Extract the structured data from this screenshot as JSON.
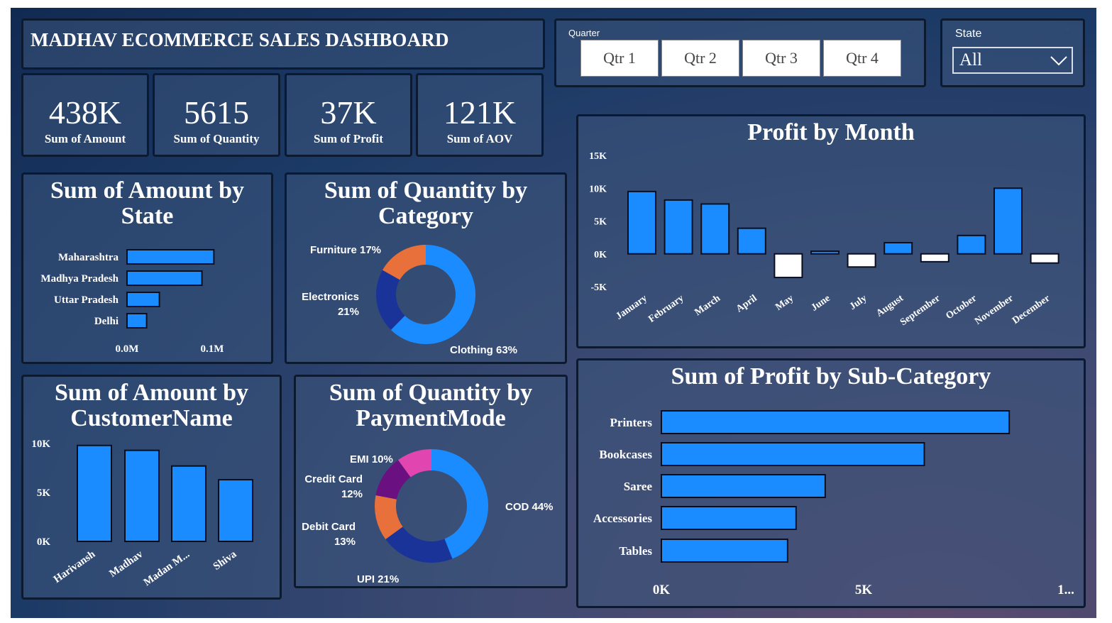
{
  "dashboard": {
    "title": "MADHAV ECOMMERCE SALES DASHBOARD"
  },
  "kpis": [
    {
      "value": "438K",
      "label": "Sum of Amount"
    },
    {
      "value": "5615",
      "label": "Sum of Quantity"
    },
    {
      "value": "37K",
      "label": "Sum of Profit"
    },
    {
      "value": "121K",
      "label": "Sum of AOV"
    }
  ],
  "quarter_slicer": {
    "label": "Quarter",
    "options": [
      "Qtr 1",
      "Qtr 2",
      "Qtr 3",
      "Qtr 4"
    ]
  },
  "state_slicer": {
    "label": "State",
    "selected": "All"
  },
  "colors": {
    "bar": "#1a8cff",
    "negative": "#ffffff",
    "outline": "#0a0f1f",
    "donut_dark": "#1a3399",
    "donut_orange": "#e8703a",
    "donut_purple": "#6b1080",
    "donut_pink": "#e045b0"
  },
  "chart_data": [
    {
      "type": "bar",
      "orientation": "horizontal",
      "title": "Sum of Amount by State",
      "categories": [
        "Maharashtra",
        "Madhya Pradesh",
        "Uttar Pradesh",
        "Delhi"
      ],
      "values": [
        0.102,
        0.088,
        0.038,
        0.023
      ],
      "tick_labels": [
        "0.0M",
        "0.1M"
      ],
      "xlim": [
        0,
        0.1
      ]
    },
    {
      "type": "pie",
      "donut": true,
      "title": "Sum of Quantity by Category",
      "categories": [
        "Clothing",
        "Electronics",
        "Furniture"
      ],
      "values": [
        63,
        21,
        17
      ],
      "labels": [
        "Clothing 63%",
        "Electronics",
        "21%",
        "Furniture 17%"
      ]
    },
    {
      "type": "bar",
      "title": "Sum of Amount by CustomerName",
      "categories": [
        "Harivansh",
        "Madhav",
        "Madan M...",
        "Shiva"
      ],
      "values": [
        9800,
        9300,
        7700,
        6300
      ],
      "tick_labels": [
        "10K",
        "5K",
        "0K"
      ],
      "ylim": [
        0,
        10000
      ]
    },
    {
      "type": "pie",
      "donut": true,
      "title": "Sum of Quantity by PaymentMode",
      "categories": [
        "COD",
        "UPI",
        "Debit Card",
        "Credit Card",
        "EMI"
      ],
      "values": [
        44,
        21,
        13,
        12,
        10
      ],
      "labels": [
        "COD 44%",
        "UPI 21%",
        "Debit Card",
        "13%",
        "Credit Card",
        "12%",
        "EMI 10%"
      ]
    },
    {
      "type": "bar",
      "title": "Profit by Month",
      "categories": [
        "January",
        "February",
        "March",
        "April",
        "May",
        "June",
        "July",
        "August",
        "September",
        "October",
        "November",
        "December"
      ],
      "values": [
        9500,
        8200,
        7600,
        3900,
        -3600,
        400,
        -2000,
        1700,
        -1200,
        2800,
        10000,
        -1400
      ],
      "tick_labels": [
        "15K",
        "10K",
        "5K",
        "0K",
        "-5K"
      ],
      "ylim": [
        -5000,
        15000
      ]
    },
    {
      "type": "bar",
      "orientation": "horizontal",
      "title": "Sum of Profit by Sub-Category",
      "categories": [
        "Printers",
        "Bookcases",
        "Saree",
        "Accessories",
        "Tables"
      ],
      "values": [
        8600,
        6500,
        4050,
        3330,
        3120
      ],
      "tick_labels": [
        "0K",
        "5K",
        "1..."
      ],
      "xlim": [
        0,
        5000
      ]
    }
  ]
}
